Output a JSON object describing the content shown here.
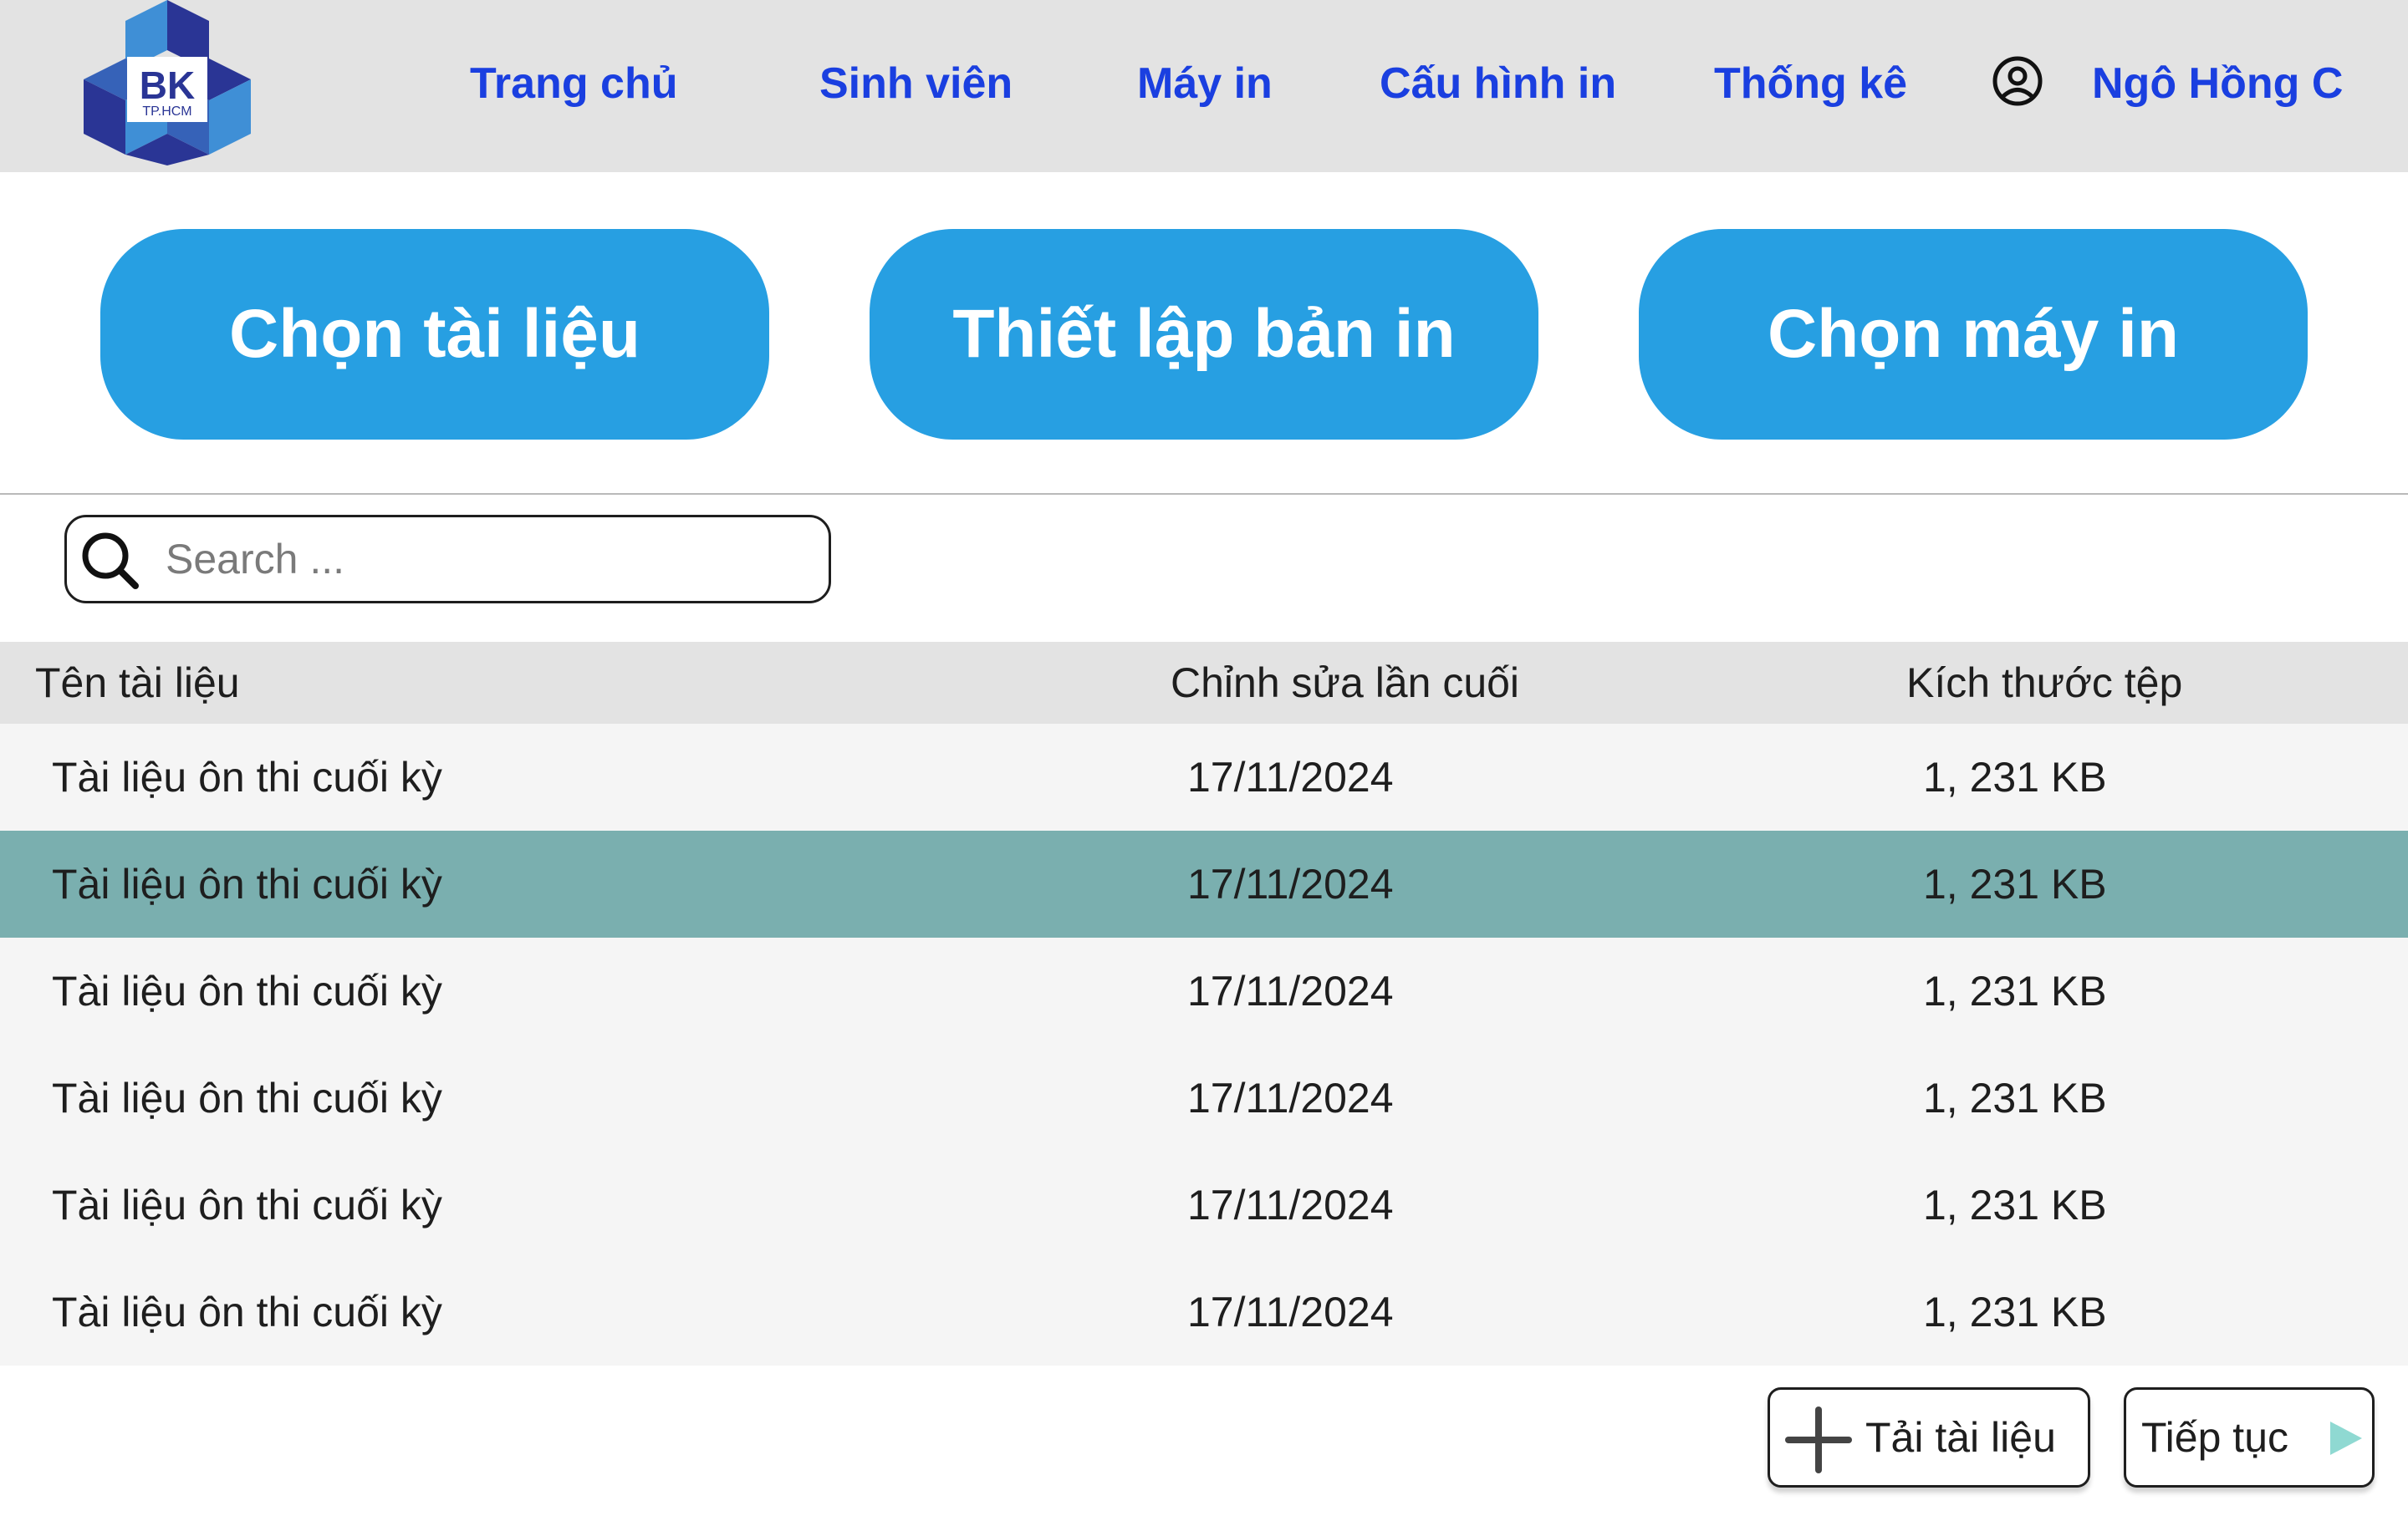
{
  "logo": {
    "text": "BK",
    "subtext": "TP.HCM",
    "colors": {
      "dark": "#2a3595",
      "light": "#3f8fd6",
      "mid": "#3662b8"
    }
  },
  "nav": {
    "items": [
      {
        "label": "Trang chủ"
      },
      {
        "label": "Sinh viên"
      },
      {
        "label": "Máy in"
      },
      {
        "label": "Cấu hình in"
      },
      {
        "label": "Thống kê"
      }
    ],
    "user_icon": "user-circle-icon",
    "user_name": "Ngô Hồng C"
  },
  "steps": [
    {
      "label": "Chọn tài liệu"
    },
    {
      "label": "Thiết lập bản in"
    },
    {
      "label": "Chọn máy in"
    }
  ],
  "search": {
    "placeholder": "Search ...",
    "value": "",
    "icon": "search-icon"
  },
  "table": {
    "columns": [
      "Tên tài liệu",
      "Chỉnh sửa lần cuối",
      "Kích thước tệp"
    ],
    "rows": [
      {
        "name": "Tài liệu ôn thi cuối kỳ",
        "modified": "17/11/2024",
        "size": "1, 231 KB",
        "selected": false
      },
      {
        "name": "Tài liệu ôn thi cuối kỳ",
        "modified": "17/11/2024",
        "size": "1, 231 KB",
        "selected": true
      },
      {
        "name": "Tài liệu ôn thi cuối kỳ",
        "modified": "17/11/2024",
        "size": "1, 231 KB",
        "selected": false
      },
      {
        "name": "Tài liệu ôn thi cuối kỳ",
        "modified": "17/11/2024",
        "size": "1, 231 KB",
        "selected": false
      },
      {
        "name": "Tài liệu ôn thi cuối kỳ",
        "modified": "17/11/2024",
        "size": "1, 231 KB",
        "selected": false
      },
      {
        "name": "Tài liệu ôn thi cuối kỳ",
        "modified": "17/11/2024",
        "size": "1, 231 KB",
        "selected": false
      }
    ]
  },
  "actions": {
    "upload_label": "Tải tài liệu",
    "upload_icon": "plus-icon",
    "continue_label": "Tiếp tục",
    "continue_icon": "play-arrow-icon"
  },
  "colors": {
    "nav_text": "#1a3fe0",
    "step_button": "#279fe2",
    "selected_row": "#7aafaf",
    "header_bg": "#e3e3e3",
    "arrow": "#8fd9d2"
  }
}
